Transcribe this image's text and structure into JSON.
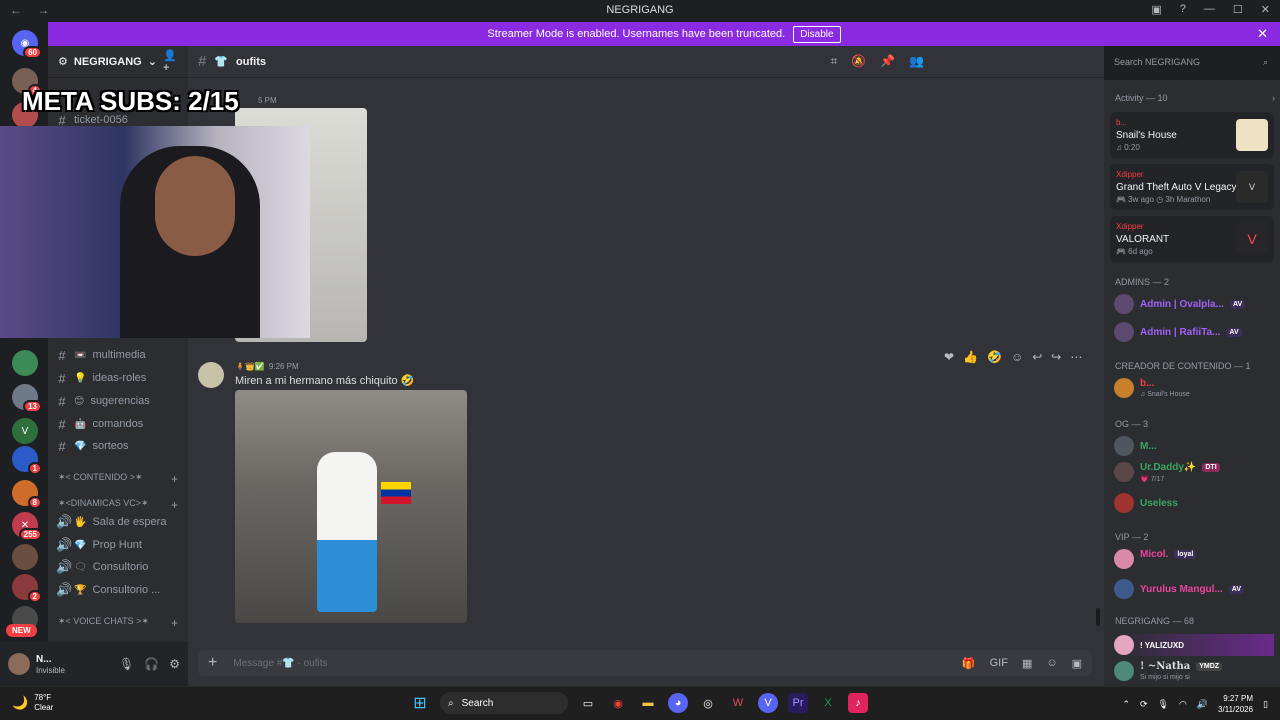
{
  "window": {
    "title": "NEGRIGANG",
    "nav": "← →"
  },
  "banner": {
    "text": "Streamer Mode is enabled. Usernames have been truncated.",
    "button": "Disable"
  },
  "guild_badges": [
    "60",
    "4",
    "13",
    "1",
    "8",
    "255",
    "2"
  ],
  "new_label": "NEW",
  "server": {
    "name": "NEGRIGANG"
  },
  "channels": [
    {
      "name": "ticket-0056",
      "emoji": ""
    },
    {
      "name": "multimedia",
      "emoji": "📼"
    },
    {
      "name": "ideas-roles",
      "emoji": "💡"
    },
    {
      "name": "sugerencias",
      "emoji": "😊"
    },
    {
      "name": "comandos",
      "emoji": "🤖"
    },
    {
      "name": "sorteos",
      "emoji": "💎"
    }
  ],
  "categories": {
    "contenido": "✶< CONTENIDO >✶",
    "dinamicas": "✶<DINAMICAS VC>✶",
    "voice": "✶< VOICE CHATS >✶"
  },
  "voice_channels": [
    {
      "name": "Sala de espera",
      "emoji": "🖐"
    },
    {
      "name": "Prop Hunt",
      "emoji": "💎"
    },
    {
      "name": "Consultorio",
      "emoji": "🗨"
    },
    {
      "name": "Consultorio ...",
      "emoji": "🏆"
    }
  ],
  "user": {
    "name": "N...",
    "status": "Invisible"
  },
  "channel_header": {
    "name": "oufits",
    "emoji": "👕"
  },
  "search": {
    "placeholder": "Search NEGRIGANG"
  },
  "overlay": {
    "text": "META SUBS: 2/15"
  },
  "prev_time": "5 PM",
  "message": {
    "time": "9:26 PM",
    "text": "Miren a mi hermano más chiquito 🤣"
  },
  "composer": {
    "placeholder": "Message #👕 · oufits"
  },
  "activity": {
    "header": "Activity — 10",
    "cards": [
      {
        "who": "b...",
        "what": "Snail's House",
        "sub": "♫ 0:20",
        "thumb_color": "#efe2c4"
      },
      {
        "who": "Xdipper",
        "what": "Grand Theft Auto V Legacy",
        "sub": "🎮 3w ago   ◷ 3h Marathon",
        "thumb_color": "#2a2a2a"
      },
      {
        "who": "Xdipper",
        "what": "VALORANT",
        "sub": "🎮 6d ago",
        "thumb_color": "#26262b"
      }
    ]
  },
  "member_groups": [
    {
      "header": "ADMINS — 2",
      "members": [
        {
          "name": "Admin | Ovalpla...",
          "tag": "AV",
          "color": "#a162f7"
        },
        {
          "name": "Admin | RafiiTa...",
          "tag": "AV",
          "color": "#a162f7"
        }
      ]
    },
    {
      "header": "CREADOR DE CONTENIDO — 1",
      "members": [
        {
          "name": "b...",
          "sub": "♫ Snail's House",
          "color": "#f23f43"
        }
      ]
    },
    {
      "header": "OG — 3",
      "members": [
        {
          "name": "M...",
          "color": "#3ba55d"
        },
        {
          "name": "Ur.Daddy✨",
          "tag": "DTI",
          "sub": "💗 7/17",
          "color": "#3ba55d"
        },
        {
          "name": "Useless",
          "color": "#3ba55d"
        }
      ]
    },
    {
      "header": "VIP — 2",
      "members": [
        {
          "name": "Micol.",
          "tag": "loyal",
          "color": "#eb459e"
        },
        {
          "name": "Yurulus Mangul...",
          "tag": "AV",
          "color": "#eb459e"
        }
      ]
    },
    {
      "header": "NEGRIGANG — 68",
      "members": [
        {
          "name": "! YALIZUXD",
          "color": "#ffffff"
        },
        {
          "name": "! ~Natha",
          "tag": "YMDZ",
          "sub": "Si mijo si mijo si",
          "color": "#dbdee1"
        }
      ]
    }
  ],
  "taskbar": {
    "weather_temp": "78°F",
    "weather_desc": "Clear",
    "search_label": "Search",
    "time": "9:27 PM",
    "date": "3/11/2026"
  }
}
